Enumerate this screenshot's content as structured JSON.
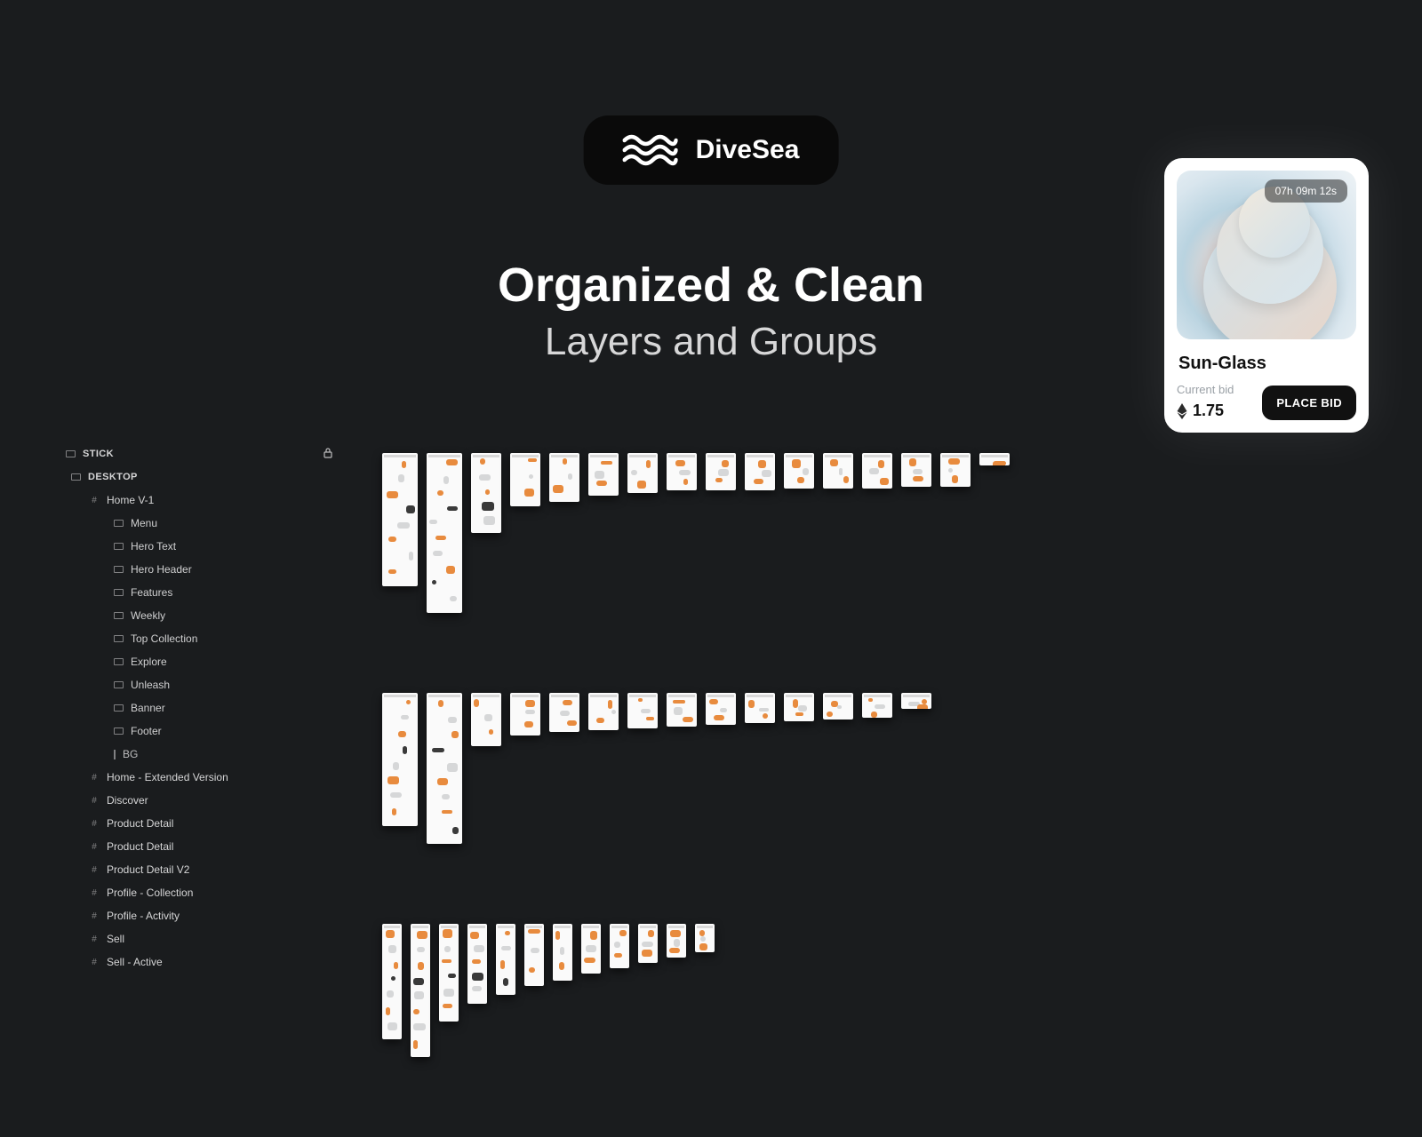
{
  "brand": {
    "name": "DiveSea"
  },
  "headline": {
    "line1": "Organized & Clean",
    "line2": "Layers and Groups"
  },
  "nft": {
    "timer": "07h 09m 12s",
    "title": "Sun-Glass",
    "bid_label": "Current bid",
    "bid_value": "1.75",
    "button": "PLACE BID"
  },
  "layers": {
    "stick": "STICK",
    "desktop": "DESKTOP",
    "frames": [
      {
        "label": "Home V-1",
        "depth": 1,
        "children": [
          "Menu",
          "Hero Text",
          "Hero Header",
          "Features",
          "Weekly",
          "Top Collection",
          "Explore",
          "Unleash",
          "Banner",
          "Footer"
        ],
        "bg": "BG"
      },
      {
        "label": "Home - Extended Version",
        "depth": 1
      },
      {
        "label": "Discover",
        "depth": 1
      },
      {
        "label": "Product Detail",
        "depth": 1
      },
      {
        "label": "Product Detail",
        "depth": 1
      },
      {
        "label": "Product Detail V2",
        "depth": 1
      },
      {
        "label": "Profile - Collection",
        "depth": 1
      },
      {
        "label": "Profile - Activity",
        "depth": 1
      },
      {
        "label": "Sell",
        "depth": 1
      },
      {
        "label": "Sell - Active",
        "depth": 1
      }
    ]
  }
}
